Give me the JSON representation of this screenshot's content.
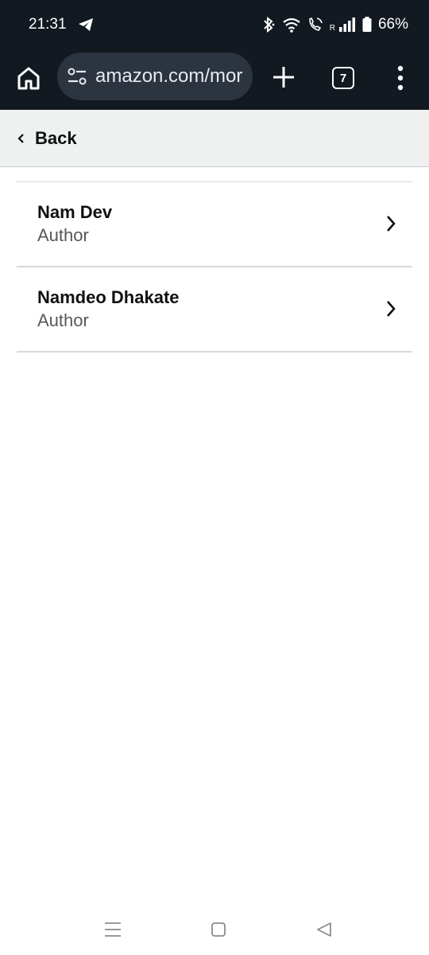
{
  "status_bar": {
    "time": "21:31",
    "network_letter": "R",
    "battery": "66%",
    "icons": [
      "telegram-icon",
      "bluetooth-icon",
      "wifi-icon",
      "wifi-calling-icon",
      "signal-icon",
      "battery-icon"
    ]
  },
  "browser": {
    "url": "amazon.com/mor",
    "tab_count": "7",
    "icons": [
      "home-icon",
      "site-settings-icon",
      "new-tab-icon",
      "tab-switcher-icon",
      "more-menu-icon"
    ]
  },
  "back_bar": {
    "label": "Back"
  },
  "results": [
    {
      "name": "Nam Dev",
      "role": "Author"
    },
    {
      "name": "Namdeo Dhakate",
      "role": "Author"
    }
  ],
  "nav_bar": {
    "icons": [
      "recents-icon",
      "home-nav-icon",
      "back-nav-icon"
    ]
  },
  "colors": {
    "header_bg": "#131921",
    "url_pill_bg": "#2c3440",
    "back_bar_bg": "#eff1f1",
    "text_primary": "#0f1111",
    "text_secondary": "#565959",
    "divider": "#d5d9d9"
  }
}
